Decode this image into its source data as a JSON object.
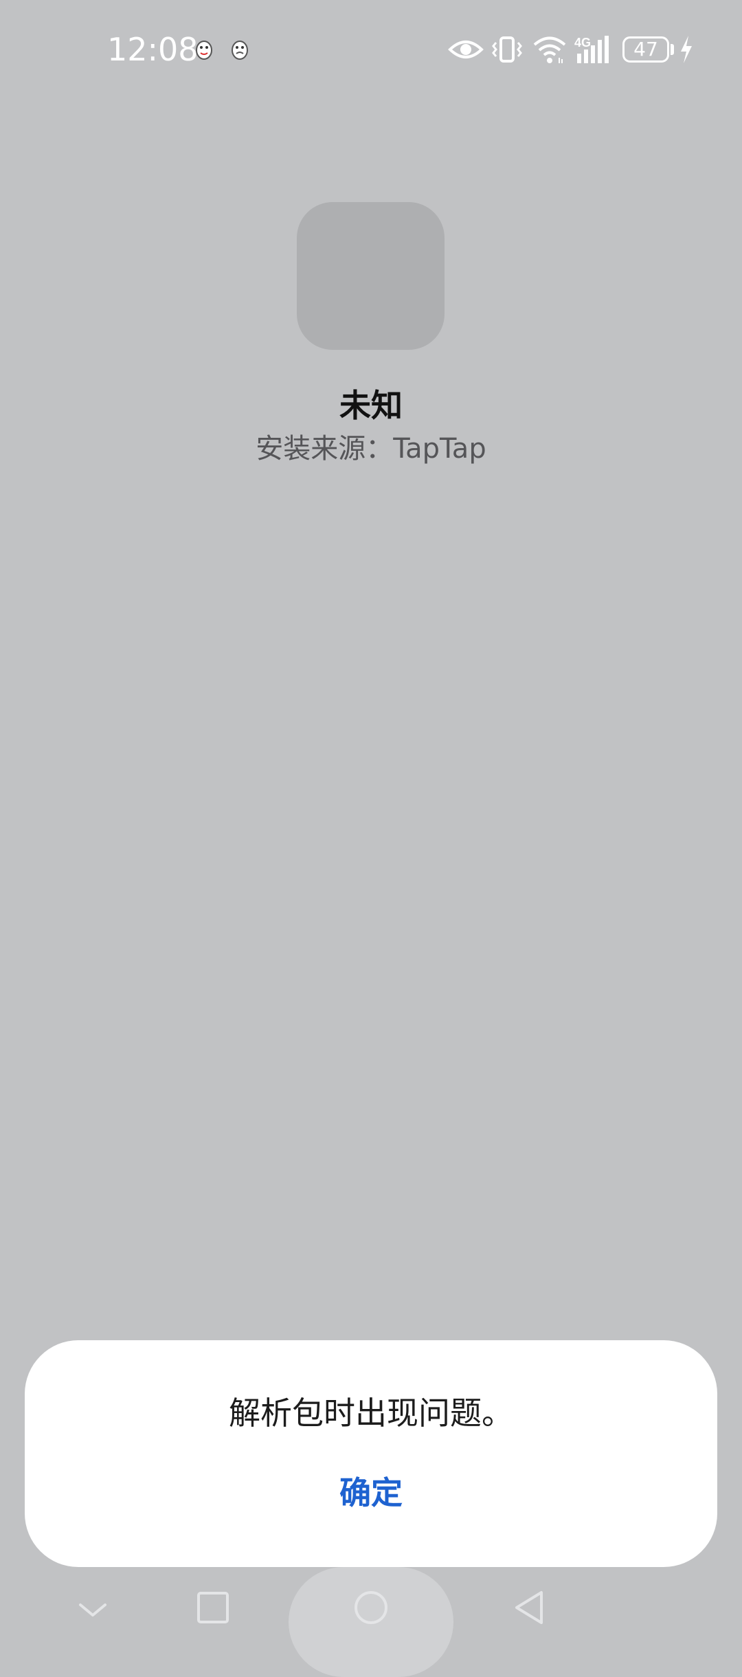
{
  "status_bar": {
    "time": "12:08",
    "battery_level": "47",
    "icons": [
      "penguin-notification-icon",
      "penguin-notification-icon",
      "eye-icon",
      "vibrate-icon",
      "wifi-icon",
      "4g-signal-icon",
      "battery-icon",
      "charging-icon"
    ],
    "network_label": "4G"
  },
  "app": {
    "name": "未知",
    "install_source": "安装来源：TapTap"
  },
  "dialog": {
    "message": "解析包时出现问题。",
    "ok_label": "确定",
    "ok_color": "#1e62d0"
  },
  "nav_bar": {
    "buttons": [
      "collapse-chevron-icon",
      "recents-square-icon",
      "home-circle-icon",
      "back-triangle-icon"
    ]
  },
  "colors": {
    "background": "#c1c2c4",
    "icon_placeholder": "#aeafb1"
  }
}
